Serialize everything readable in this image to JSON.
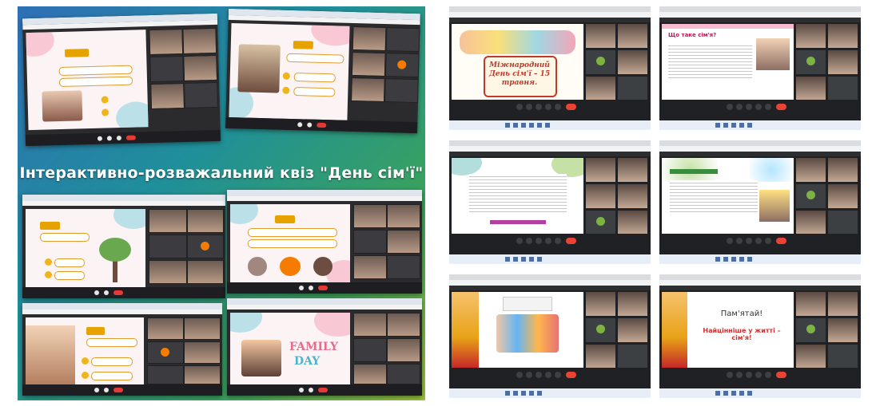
{
  "collage": {
    "banner": "Інтерактивно-розважальний квіз \"День сім'ї\"",
    "family_word": "FAMILY",
    "day_word": "DAY",
    "colors": {
      "banner_text": "#ffffff",
      "accent": "#e6a300",
      "end_call": "#e53935"
    }
  },
  "grid": {
    "slide1_title": "Міжнародний День сім'ї – 15 травня.",
    "slide2_question": "Що таке сім'я?",
    "slide5_title": "Пам'ятай!",
    "slide5_subtitle": "Найцінніше у житті – сім'я!"
  }
}
